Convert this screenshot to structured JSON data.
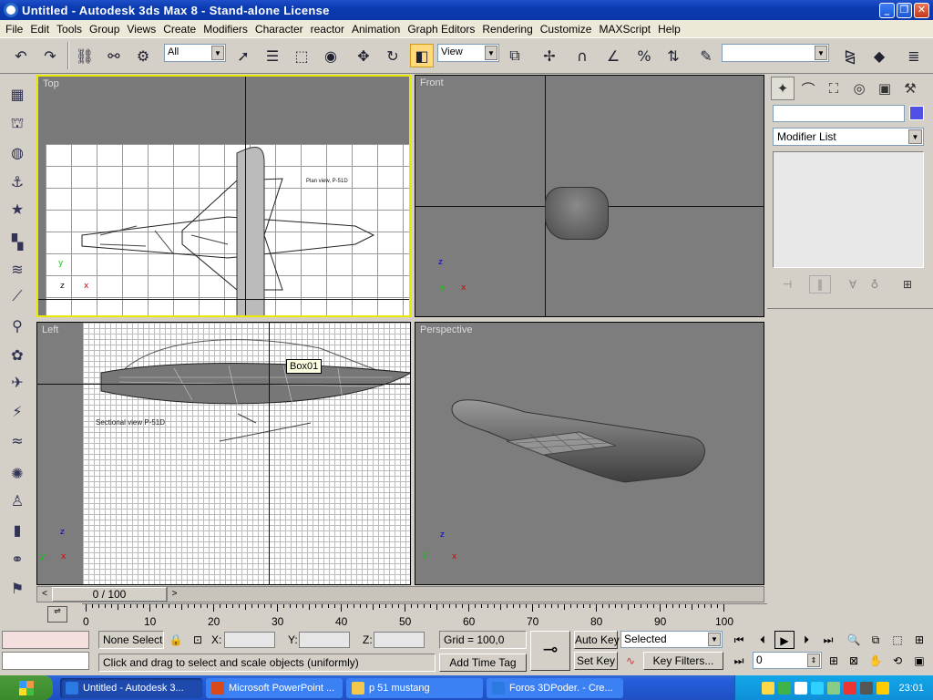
{
  "window": {
    "title": "Untitled - Autodesk 3ds Max 8 - Stand-alone License"
  },
  "menu": [
    "File",
    "Edit",
    "Tools",
    "Group",
    "Views",
    "Create",
    "Modifiers",
    "Character",
    "reactor",
    "Animation",
    "Graph Editors",
    "Rendering",
    "Customize",
    "MAXScript",
    "Help"
  ],
  "toolbar": {
    "selection_filter": "All",
    "ref_coord": "View",
    "named_selection": "",
    "icons": [
      "undo-icon",
      "redo-icon",
      "select-link-icon",
      "unlink-icon",
      "bind-space-warp-icon",
      "select-object-icon",
      "select-by-name-icon",
      "rect-selection-icon",
      "window-crossing-icon",
      "select-move-icon",
      "select-rotate-icon",
      "select-scale-icon",
      "pivot-center-icon",
      "manipulate-icon",
      "snap-3d-icon",
      "angle-snap-icon",
      "percent-snap-icon",
      "spinner-snap-icon",
      "edit-named-selections-icon",
      "mirror-icon",
      "align-icon",
      "layer-manager-icon"
    ]
  },
  "viewports": {
    "top": {
      "label": "Top"
    },
    "front": {
      "label": "Front"
    },
    "left": {
      "label": "Left",
      "tooltip": "Box01"
    },
    "perspective": {
      "label": "Perspective"
    }
  },
  "blueprint_text": {
    "plan": "Plan view, P-51D",
    "side": "Sectional view P-51D"
  },
  "command_panel": {
    "tabs": [
      "create-tab-icon",
      "modify-tab-icon",
      "hierarchy-tab-icon",
      "motion-tab-icon",
      "display-tab-icon",
      "utilities-tab-icon"
    ],
    "name_value": "",
    "object_color": "#5050e6",
    "modifier_list": "Modifier List"
  },
  "time_slider": {
    "position": "0 / 100"
  },
  "trackbar": {
    "ticks": [
      "0",
      "10",
      "20",
      "30",
      "40",
      "50",
      "60",
      "70",
      "80",
      "90",
      "100"
    ]
  },
  "status": {
    "selection": "None Selecte",
    "x_label": "X:",
    "y_label": "Y:",
    "z_label": "Z:",
    "grid": "Grid = 100,0",
    "prompt": "Click and drag to select and scale objects (uniformly)",
    "add_time_tag": "Add Time Tag",
    "auto_key": "Auto Key",
    "set_key": "Set Key",
    "key_mode": "Selected",
    "key_filters": "Key Filters...",
    "frame": "0"
  },
  "taskbar": {
    "tasks": [
      {
        "label": "Untitled - Autodesk 3...",
        "color": "#2a7ae2",
        "active": true
      },
      {
        "label": "Microsoft PowerPoint ...",
        "color": "#d84a1a",
        "active": false
      },
      {
        "label": "p 51 mustang",
        "color": "#f2c94c",
        "active": false
      },
      {
        "label": "Foros 3DPoder. - Cre...",
        "color": "#2a7ae2",
        "active": false
      }
    ],
    "clock": "23:01"
  }
}
